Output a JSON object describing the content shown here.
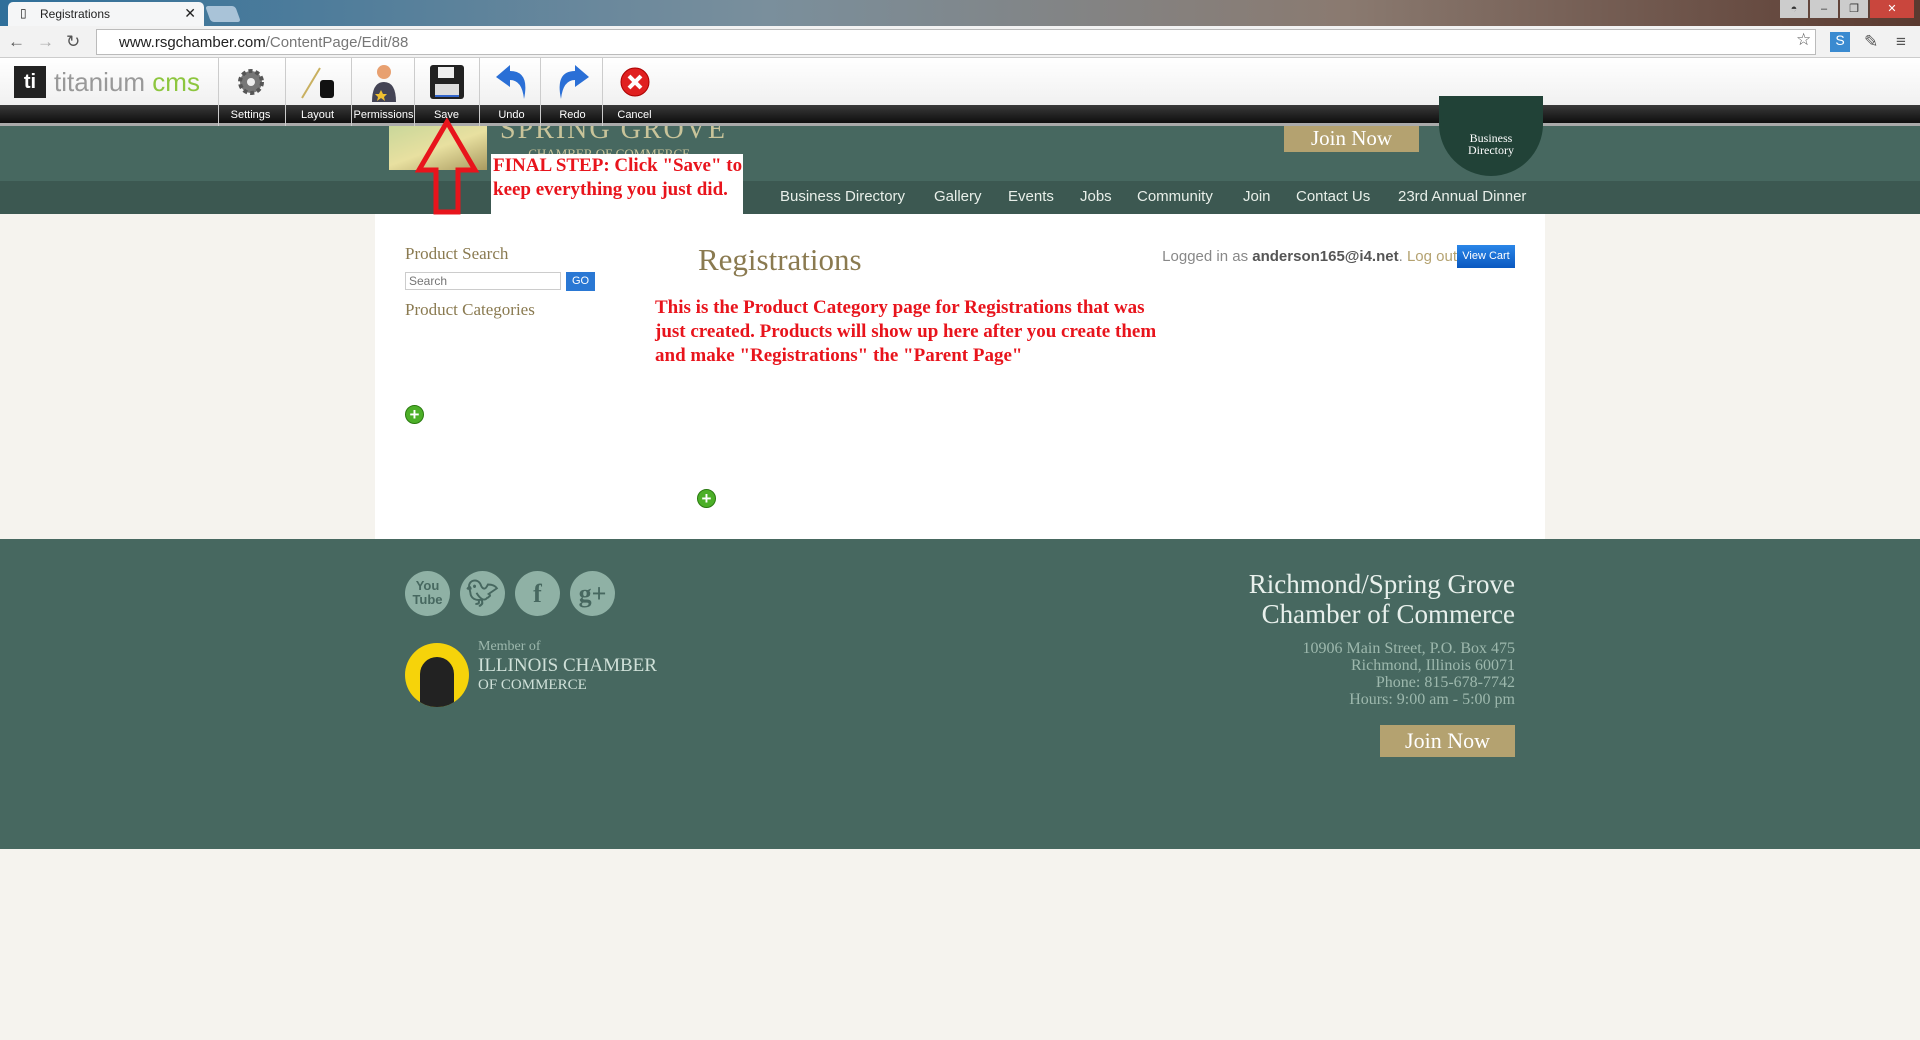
{
  "browser": {
    "tab_title": "Registrations",
    "url_host": "www.rsgchamber.com",
    "url_path": "/ContentPage/Edit/88"
  },
  "cms": {
    "logo_main": "titanium",
    "logo_accent": "cms",
    "buttons": [
      {
        "label": "Settings",
        "icon": "gear-icon"
      },
      {
        "label": "Layout",
        "icon": "ink-brush-icon"
      },
      {
        "label": "Permissions",
        "icon": "user-icon"
      },
      {
        "label": "Save",
        "icon": "floppy-disk-icon"
      },
      {
        "label": "Undo",
        "icon": "undo-icon"
      },
      {
        "label": "Redo",
        "icon": "redo-icon"
      },
      {
        "label": "Cancel",
        "icon": "cancel-icon"
      }
    ]
  },
  "header": {
    "logo_line1": "SPRING GROVE",
    "logo_line2": "— CHAMBER OF COMMERCE —",
    "join_now": "Join Now",
    "business_directory": "Business Directory"
  },
  "nav": {
    "items": [
      "Business Directory",
      "Gallery",
      "Events",
      "Jobs",
      "Community",
      "Join",
      "Contact Us",
      "23rd Annual Dinner"
    ]
  },
  "annotation": {
    "callout": "FINAL STEP: Click \"Save\" to keep everything you just did.",
    "note": "This is the Product Category page for Registrations that was just created. Products will show up here after you create them and make \"Registrations\" the \"Parent Page\""
  },
  "sidebar": {
    "search_title": "Product Search",
    "search_placeholder": "Search",
    "go": "GO",
    "categories_title": "Product Categories"
  },
  "main": {
    "title": "Registrations",
    "logged_in_prefix": "Logged in as",
    "user": "anderson165@i4.net",
    "logout": "Log out",
    "view_cart": "View Cart"
  },
  "footer": {
    "social": [
      "YouTube",
      "Twitter",
      "Facebook",
      "Google+"
    ],
    "member_of": "Member of",
    "illinois_line1": "ILLINOIS CHAMBER",
    "illinois_line2": "OF COMMERCE",
    "org_line1": "Richmond/Spring Grove",
    "org_line2": "Chamber of Commerce",
    "address": [
      "10906 Main Street, P.O. Box 475",
      "Richmond, Illinois 60071",
      "Phone: 815-678-7742",
      "Hours: 9:00 am - 5:00 pm"
    ],
    "join_now": "Join Now"
  },
  "colors": {
    "green": "#476860",
    "nav": "#3c5851",
    "gold": "#b4a270",
    "annotation_red": "#e8141c",
    "link_blue": "#1a6fd6"
  }
}
